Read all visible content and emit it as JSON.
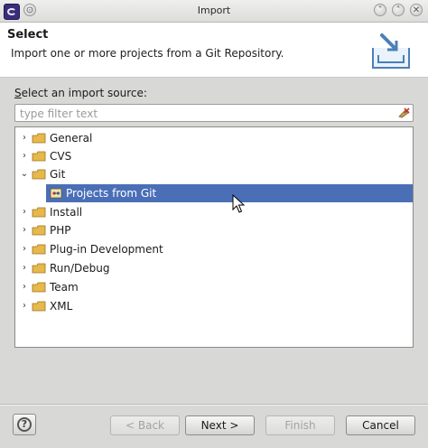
{
  "window": {
    "title": "Import",
    "controls": [
      "chevron-down-icon",
      "chevron-up-icon",
      "close-icon"
    ]
  },
  "header": {
    "title": "Select",
    "description": "Import one or more projects from a Git Repository."
  },
  "source": {
    "label_mnemonic": "S",
    "label_rest": "elect an import source:",
    "filter_placeholder": "type filter text",
    "filter_value": ""
  },
  "tree": {
    "items": [
      {
        "label": "General",
        "expanded": false
      },
      {
        "label": "CVS",
        "expanded": false
      },
      {
        "label": "Git",
        "expanded": true
      },
      {
        "label": "Projects from Git",
        "child": true,
        "selected": true
      },
      {
        "label": "Install",
        "expanded": false
      },
      {
        "label": "PHP",
        "expanded": false
      },
      {
        "label": "Plug-in Development",
        "expanded": false
      },
      {
        "label": "Run/Debug",
        "expanded": false
      },
      {
        "label": "Team",
        "expanded": false
      },
      {
        "label": "XML",
        "expanded": false
      }
    ]
  },
  "buttons": {
    "back": "< Back",
    "next": "Next >",
    "finish": "Finish",
    "cancel": "Cancel"
  },
  "colors": {
    "selection": "#4a6fb7",
    "folder": "#e7b84a"
  }
}
